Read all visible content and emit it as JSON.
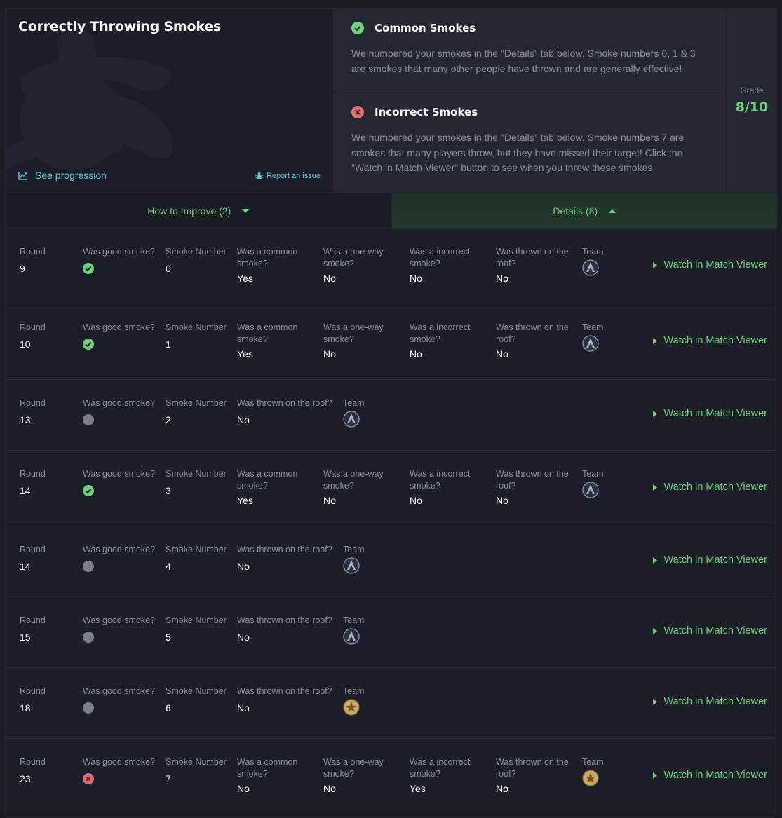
{
  "header": {
    "title": "Correctly Throwing Smokes",
    "see_progression": "See progression",
    "report_issue": "Report an issue"
  },
  "feedback": [
    {
      "title": "Common Smokes",
      "status": "good",
      "description": "We numbered your smokes in the \"Details\" tab below. Smoke numbers 0, 1 & 3 are smokes that many other people have thrown and are generally effective!"
    },
    {
      "title": "Incorrect Smokes",
      "status": "bad",
      "description": "We numbered your smokes in the \"Details\" tab below. Smoke numbers 7 are smokes that many players throw, but they have missed their target! Click the \"Watch in Match Viewer\" button to see when you threw these smokes."
    }
  ],
  "grade": {
    "label": "Grade",
    "value": "8/10"
  },
  "tabs": {
    "improve": "How to Improve (2)",
    "details": "Details (8)"
  },
  "labels": {
    "round": "Round",
    "good": "Was good smoke?",
    "number": "Smoke Number",
    "common": "Was a common smoke?",
    "oneway": "Was a one-way smoke?",
    "incorrect": "Was a incorrect smoke?",
    "roof": "Was thrown on the roof?",
    "team": "Team",
    "watch": "Watch in Match Viewer"
  },
  "rows": [
    {
      "round": "9",
      "good": "good",
      "number": "0",
      "common": "Yes",
      "oneway": "No",
      "incorrect": "No",
      "roof": "No",
      "team": "ct",
      "layout": "full"
    },
    {
      "round": "10",
      "good": "good",
      "number": "1",
      "common": "Yes",
      "oneway": "No",
      "incorrect": "No",
      "roof": "No",
      "team": "ct",
      "layout": "full"
    },
    {
      "round": "13",
      "good": "neutral",
      "number": "2",
      "roof": "No",
      "team": "ct",
      "layout": "short"
    },
    {
      "round": "14",
      "good": "good",
      "number": "3",
      "common": "Yes",
      "oneway": "No",
      "incorrect": "No",
      "roof": "No",
      "team": "ct",
      "layout": "full"
    },
    {
      "round": "14",
      "good": "neutral",
      "number": "4",
      "roof": "No",
      "team": "ct",
      "layout": "short"
    },
    {
      "round": "15",
      "good": "neutral",
      "number": "5",
      "roof": "No",
      "team": "ct",
      "layout": "short"
    },
    {
      "round": "18",
      "good": "neutral",
      "number": "6",
      "roof": "No",
      "team": "t",
      "layout": "short"
    },
    {
      "round": "23",
      "good": "bad",
      "number": "7",
      "common": "No",
      "oneway": "No",
      "incorrect": "Yes",
      "roof": "No",
      "team": "t",
      "layout": "full"
    }
  ],
  "colors": {
    "accent_green": "#6fcf7c",
    "accent_cyan": "#5ec9d3",
    "bad_red": "#e06c75"
  }
}
